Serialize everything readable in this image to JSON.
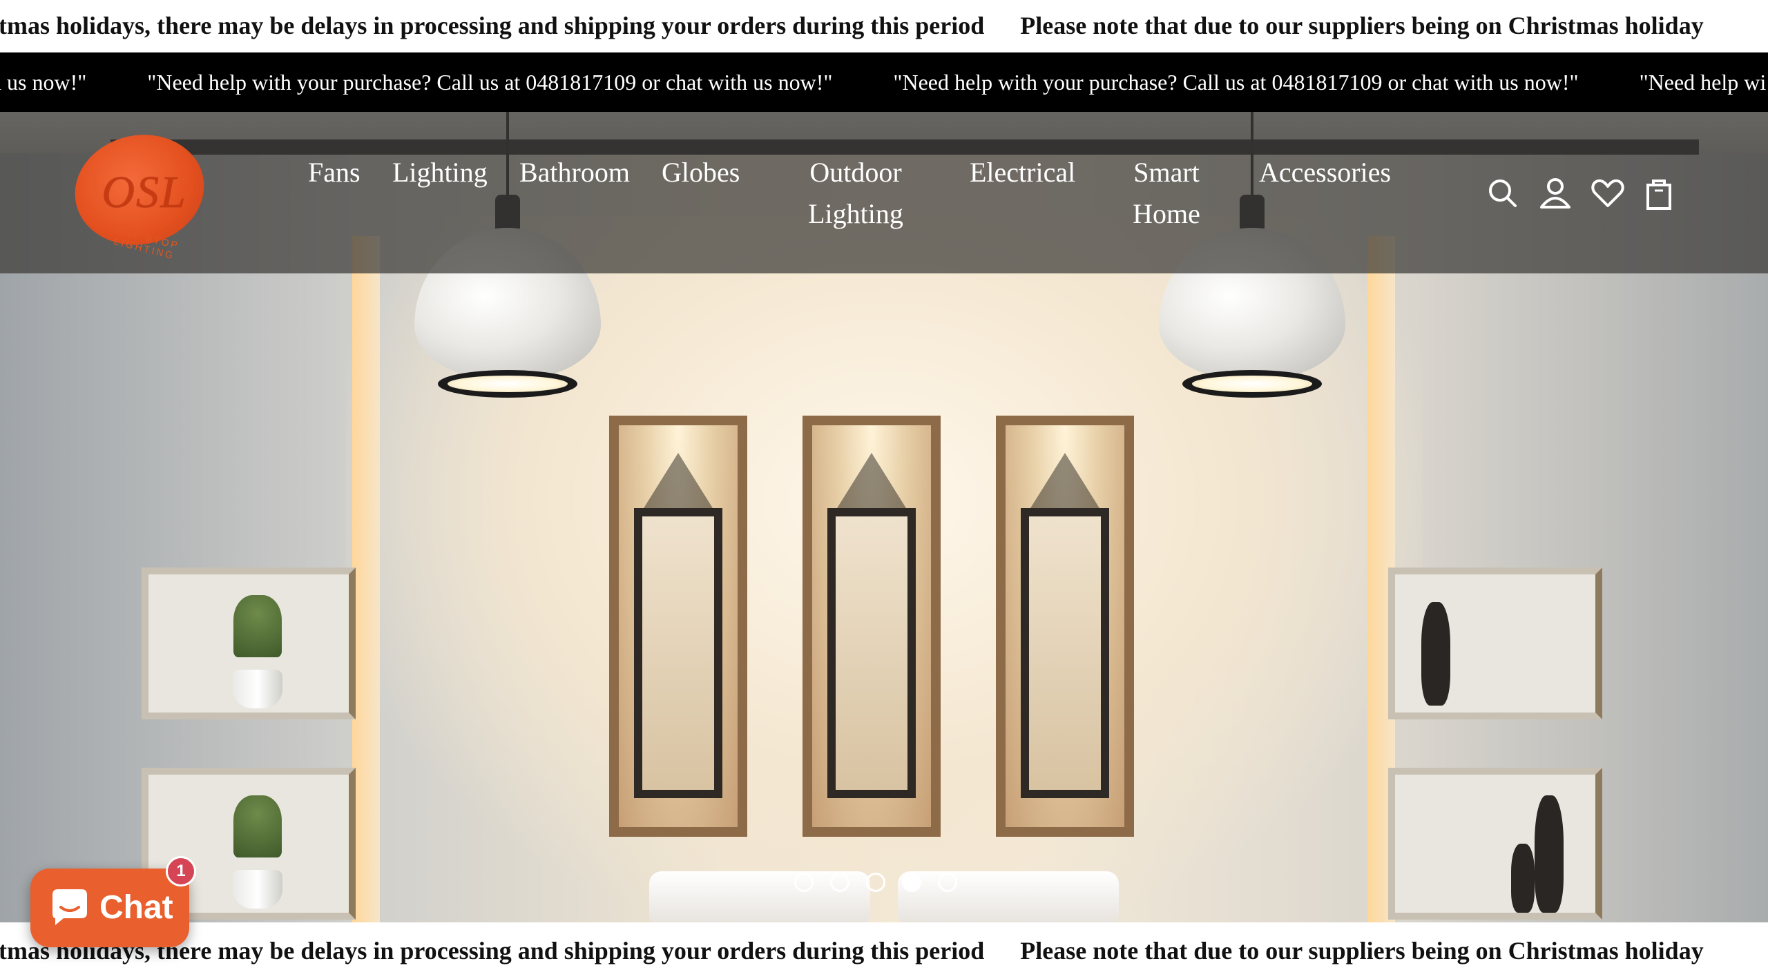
{
  "announcement_top": {
    "message_partial": "hristmas holidays, there may be delays in processing and shipping your orders during this period",
    "message_full_start": "Please note that due to our suppliers being on Christmas holiday"
  },
  "help_bar": {
    "message_partial": "h us now!\"",
    "message": "\"Need help with your purchase? Call us at 0481817109 or chat with us now!\"",
    "message_tail": "\"Need help wi"
  },
  "header": {
    "logo_text": "OSL",
    "logo_tagline": "ONE STOP LIGHTING",
    "brand_color": "#e4501f",
    "nav": [
      {
        "label": "Fans"
      },
      {
        "label": "Lighting"
      },
      {
        "label": "Bathroom"
      },
      {
        "label": "Globes"
      },
      {
        "label": "Outdoor Lighting"
      },
      {
        "label": "Electrical"
      },
      {
        "label": "Smart Home"
      },
      {
        "label": "Accessories"
      }
    ],
    "actions": [
      {
        "icon": "search-icon"
      },
      {
        "icon": "account-icon"
      },
      {
        "icon": "wishlist-heart-icon"
      },
      {
        "icon": "shopping-bag-icon"
      }
    ]
  },
  "hero": {
    "slide_count": 5,
    "active_slide": 4
  },
  "announcement_bottom": {
    "message_partial": "hristmas holidays, there may be delays in processing and shipping your orders during this period",
    "message_full_start": "Please note that due to our suppliers being on Christmas holiday"
  },
  "chat_widget": {
    "label": "Chat",
    "unread_count": "1",
    "color": "#e95f2d"
  }
}
